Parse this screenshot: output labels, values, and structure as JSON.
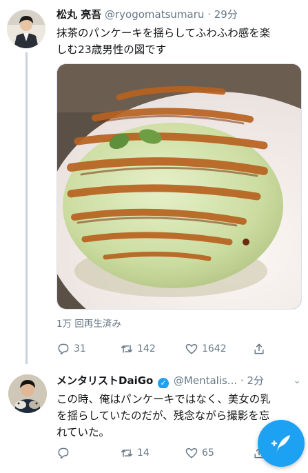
{
  "tweets": [
    {
      "display_name": "松丸 亮吾",
      "handle": "@ryogomatsumaru",
      "time": "29分",
      "text_line1": "抹茶のパンケーキを揺らしてふわふわ感を楽",
      "text_line2": "しむ23歳男性の図です",
      "views": "1万 回再生済み",
      "replies": "31",
      "retweets": "142",
      "likes": "1642"
    },
    {
      "display_name": "メンタリストDaiGo",
      "handle": "@Mentalis...",
      "time": "2分",
      "verified": "✓",
      "text_line1": "この時、俺はパンケーキではなく、美女の乳",
      "text_line2": "を揺らしていたのだが、残念ながら撮影を忘",
      "text_line3": "れていた。",
      "replies": "",
      "retweets": "14",
      "likes": "65"
    }
  ],
  "separator": "·",
  "caret": "⌄",
  "colors": {
    "accent": "#1da1f2",
    "secondary_text": "#657786",
    "thread_line": "#c9d2d9"
  },
  "icons": [
    "reply-icon",
    "retweet-icon",
    "like-icon",
    "share-icon",
    "compose-icon",
    "verified-icon",
    "chevron-down-icon"
  ]
}
